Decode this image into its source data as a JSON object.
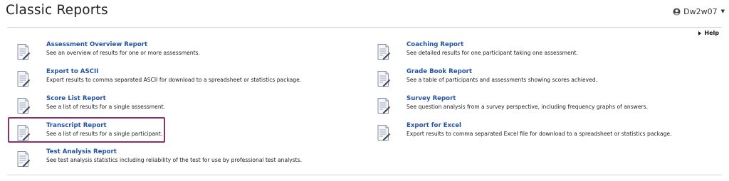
{
  "header": {
    "title": "Classic Reports",
    "user_name": "Dw2w07"
  },
  "help": {
    "label": "Help"
  },
  "reports": [
    {
      "id": "assessment-overview",
      "title": "Assessment Overview Report",
      "description": "See an overview of results for one or more assessments."
    },
    {
      "id": "export-ascii",
      "title": "Export to ASCII",
      "description": "Export results to comma separated ASCII for download to a spreadsheet or statistics package."
    },
    {
      "id": "score-list",
      "title": "Score List Report",
      "description": "See a list of results for a single assessment."
    },
    {
      "id": "transcript",
      "title": "Transcript Report",
      "description": "See a list of results for a single participant."
    },
    {
      "id": "test-analysis",
      "title": "Test Analysis Report",
      "description": "See test analysis statistics including reliability of the test for use by professional test analysts."
    },
    {
      "id": "coaching",
      "title": "Coaching Report",
      "description": "See detailed results for one participant taking one assessment."
    },
    {
      "id": "grade-book",
      "title": "Grade Book Report",
      "description": "See a table of participants and assessments showing scores achieved."
    },
    {
      "id": "survey",
      "title": "Survey Report",
      "description": "See question analysis from a survey perspective, including frequency graphs of answers."
    },
    {
      "id": "export-excel",
      "title": "Export for Excel",
      "description": "Export results to comma separated Excel file for download to a spreadsheet or statistics package."
    }
  ],
  "highlighted_report": "transcript",
  "colors": {
    "link": "#2353a6",
    "highlight_border": "#8c2f6d"
  },
  "icons": {
    "report": "report-document-icon",
    "user": "user-circle-icon",
    "caret": "caret-down-icon",
    "help": "triangle-right-icon"
  }
}
